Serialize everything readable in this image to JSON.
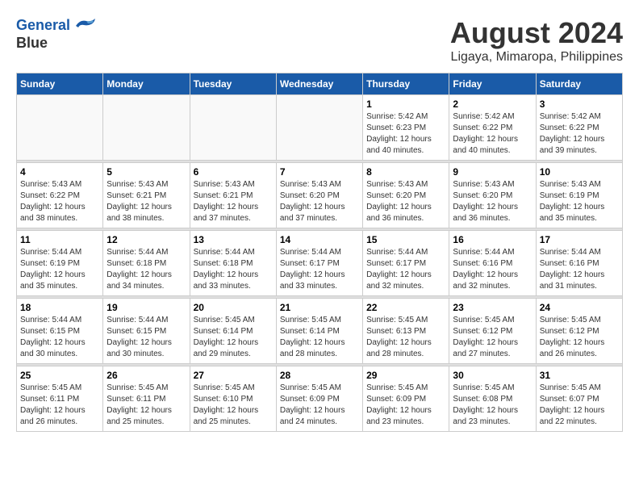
{
  "logo": {
    "line1": "General",
    "line2": "Blue"
  },
  "title": "August 2024",
  "subtitle": "Ligaya, Mimaropa, Philippines",
  "days_of_week": [
    "Sunday",
    "Monday",
    "Tuesday",
    "Wednesday",
    "Thursday",
    "Friday",
    "Saturday"
  ],
  "weeks": [
    [
      {
        "day": "",
        "info": ""
      },
      {
        "day": "",
        "info": ""
      },
      {
        "day": "",
        "info": ""
      },
      {
        "day": "",
        "info": ""
      },
      {
        "day": "1",
        "info": "Sunrise: 5:42 AM\nSunset: 6:23 PM\nDaylight: 12 hours\nand 40 minutes."
      },
      {
        "day": "2",
        "info": "Sunrise: 5:42 AM\nSunset: 6:22 PM\nDaylight: 12 hours\nand 40 minutes."
      },
      {
        "day": "3",
        "info": "Sunrise: 5:42 AM\nSunset: 6:22 PM\nDaylight: 12 hours\nand 39 minutes."
      }
    ],
    [
      {
        "day": "4",
        "info": "Sunrise: 5:43 AM\nSunset: 6:22 PM\nDaylight: 12 hours\nand 38 minutes."
      },
      {
        "day": "5",
        "info": "Sunrise: 5:43 AM\nSunset: 6:21 PM\nDaylight: 12 hours\nand 38 minutes."
      },
      {
        "day": "6",
        "info": "Sunrise: 5:43 AM\nSunset: 6:21 PM\nDaylight: 12 hours\nand 37 minutes."
      },
      {
        "day": "7",
        "info": "Sunrise: 5:43 AM\nSunset: 6:20 PM\nDaylight: 12 hours\nand 37 minutes."
      },
      {
        "day": "8",
        "info": "Sunrise: 5:43 AM\nSunset: 6:20 PM\nDaylight: 12 hours\nand 36 minutes."
      },
      {
        "day": "9",
        "info": "Sunrise: 5:43 AM\nSunset: 6:20 PM\nDaylight: 12 hours\nand 36 minutes."
      },
      {
        "day": "10",
        "info": "Sunrise: 5:43 AM\nSunset: 6:19 PM\nDaylight: 12 hours\nand 35 minutes."
      }
    ],
    [
      {
        "day": "11",
        "info": "Sunrise: 5:44 AM\nSunset: 6:19 PM\nDaylight: 12 hours\nand 35 minutes."
      },
      {
        "day": "12",
        "info": "Sunrise: 5:44 AM\nSunset: 6:18 PM\nDaylight: 12 hours\nand 34 minutes."
      },
      {
        "day": "13",
        "info": "Sunrise: 5:44 AM\nSunset: 6:18 PM\nDaylight: 12 hours\nand 33 minutes."
      },
      {
        "day": "14",
        "info": "Sunrise: 5:44 AM\nSunset: 6:17 PM\nDaylight: 12 hours\nand 33 minutes."
      },
      {
        "day": "15",
        "info": "Sunrise: 5:44 AM\nSunset: 6:17 PM\nDaylight: 12 hours\nand 32 minutes."
      },
      {
        "day": "16",
        "info": "Sunrise: 5:44 AM\nSunset: 6:16 PM\nDaylight: 12 hours\nand 32 minutes."
      },
      {
        "day": "17",
        "info": "Sunrise: 5:44 AM\nSunset: 6:16 PM\nDaylight: 12 hours\nand 31 minutes."
      }
    ],
    [
      {
        "day": "18",
        "info": "Sunrise: 5:44 AM\nSunset: 6:15 PM\nDaylight: 12 hours\nand 30 minutes."
      },
      {
        "day": "19",
        "info": "Sunrise: 5:44 AM\nSunset: 6:15 PM\nDaylight: 12 hours\nand 30 minutes."
      },
      {
        "day": "20",
        "info": "Sunrise: 5:45 AM\nSunset: 6:14 PM\nDaylight: 12 hours\nand 29 minutes."
      },
      {
        "day": "21",
        "info": "Sunrise: 5:45 AM\nSunset: 6:14 PM\nDaylight: 12 hours\nand 28 minutes."
      },
      {
        "day": "22",
        "info": "Sunrise: 5:45 AM\nSunset: 6:13 PM\nDaylight: 12 hours\nand 28 minutes."
      },
      {
        "day": "23",
        "info": "Sunrise: 5:45 AM\nSunset: 6:12 PM\nDaylight: 12 hours\nand 27 minutes."
      },
      {
        "day": "24",
        "info": "Sunrise: 5:45 AM\nSunset: 6:12 PM\nDaylight: 12 hours\nand 26 minutes."
      }
    ],
    [
      {
        "day": "25",
        "info": "Sunrise: 5:45 AM\nSunset: 6:11 PM\nDaylight: 12 hours\nand 26 minutes."
      },
      {
        "day": "26",
        "info": "Sunrise: 5:45 AM\nSunset: 6:11 PM\nDaylight: 12 hours\nand 25 minutes."
      },
      {
        "day": "27",
        "info": "Sunrise: 5:45 AM\nSunset: 6:10 PM\nDaylight: 12 hours\nand 25 minutes."
      },
      {
        "day": "28",
        "info": "Sunrise: 5:45 AM\nSunset: 6:09 PM\nDaylight: 12 hours\nand 24 minutes."
      },
      {
        "day": "29",
        "info": "Sunrise: 5:45 AM\nSunset: 6:09 PM\nDaylight: 12 hours\nand 23 minutes."
      },
      {
        "day": "30",
        "info": "Sunrise: 5:45 AM\nSunset: 6:08 PM\nDaylight: 12 hours\nand 23 minutes."
      },
      {
        "day": "31",
        "info": "Sunrise: 5:45 AM\nSunset: 6:07 PM\nDaylight: 12 hours\nand 22 minutes."
      }
    ]
  ]
}
